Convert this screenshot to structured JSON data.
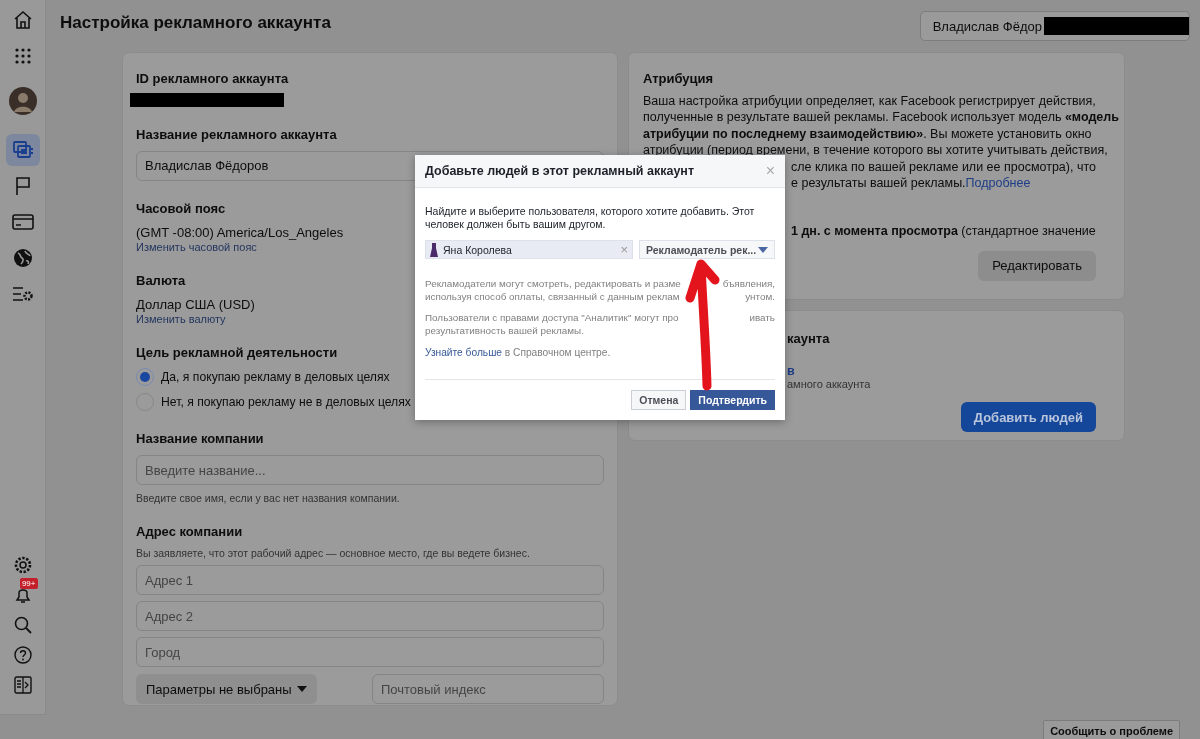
{
  "sidebar": {
    "top_items": [
      {
        "selected": false
      },
      {
        "selected": false
      },
      {
        "selected": false
      },
      {
        "selected": true
      },
      {
        "selected": false
      },
      {
        "selected": false
      },
      {
        "selected": false
      },
      {
        "selected": false
      }
    ],
    "notification_badge": "99+"
  },
  "header": {
    "title": "Настройка рекламного аккаунта",
    "account_button": "Владислав Фёдор"
  },
  "account_card": {
    "id_label": "ID рекламного аккаунта",
    "name_label": "Название рекламного аккаунта",
    "name_value": "Владислав Фёдоров",
    "timezone_label": "Часовой пояс",
    "timezone_value": "(GMT -08:00) America/Los_Angeles",
    "timezone_link": "Изменить часовой пояс",
    "currency_label": "Валюта",
    "currency_value": "Доллар США (USD)",
    "currency_link": "Изменить валюту",
    "purpose_label": "Цель рекламной деятельности",
    "purpose_options": [
      {
        "label": "Да, я покупаю рекламу в деловых целях",
        "selected": true
      },
      {
        "label": "Нет, я покупаю рекламу не в деловых целях",
        "selected": false
      }
    ],
    "company_label": "Название компании",
    "company_placeholder": "Введите название...",
    "company_hint": "Введите свое имя, если у вас нет названия компании.",
    "address_label": "Адрес компании",
    "address_hint": "Вы заявляете, что этот рабочий адрес — основное место, где вы ведете бизнес.",
    "address_fields": [
      {
        "placeholder": "Адрес 1"
      },
      {
        "placeholder": "Адрес 2"
      },
      {
        "placeholder": "Город"
      }
    ],
    "region_select": "Параметры не выбраны",
    "zip_placeholder": "Почтовый индекс"
  },
  "attribution_card": {
    "title": "Атрибуция",
    "lines": [
      {
        "text": "Ваша настройка атрибуции определяет, как Facebook регистрирует действия,"
      },
      {
        "text": "полученные в результате вашей рекламы. Facebook использует модель **«модель**"
      },
      {
        "text": "**атрибуции по последнему взаимодействию»**. Вы можете установить окно"
      },
      {
        "text": "атрибуции (период времени, в течение которого вы хотите учитывать действия,"
      },
      {
        "text": "сле клика по вашей рекламе или ее просмотра), что"
      },
      {
        "text": "е результаты вашей рекламы.",
        "link": "Подробнее"
      }
    ],
    "setting_line": "**1 дн. с момента просмотра** (стандартное значение",
    "edit_button": "Редактировать"
  },
  "people_card": {
    "title": "каунта",
    "link": "в",
    "subtitle": "амного аккаунта",
    "add_button": "Добавить людей"
  },
  "report_button": "Сообщить о проблеме",
  "dialog": {
    "title": "Добавьте людей в этот рекламный аккаунт",
    "close": "×",
    "intro": "Найдите и выберите пользователя, которого хотите добавить. Этот человек должен быть вашим другом.",
    "person_token": {
      "name": "Яна Королева",
      "remove": "×"
    },
    "role_select": "Рекламодатель рек...",
    "info_lines": [
      {
        "left": "Рекламодатели могут смотреть, редактировать и разме",
        "right": "бъявления,"
      },
      {
        "left": "используя способ оплаты, связанный с данным реклам",
        "right": "унтом."
      },
      {
        "left": "Пользователи с правами доступа \"Аналитик\" могут про",
        "right": "ивать"
      },
      {
        "left": "результативность вашей рекламы."
      }
    ],
    "help_link": "Узнайте больше",
    "help_rest": "в Справочном центре.",
    "cancel_button": "Отмена",
    "confirm_button": "Подтвердить"
  }
}
